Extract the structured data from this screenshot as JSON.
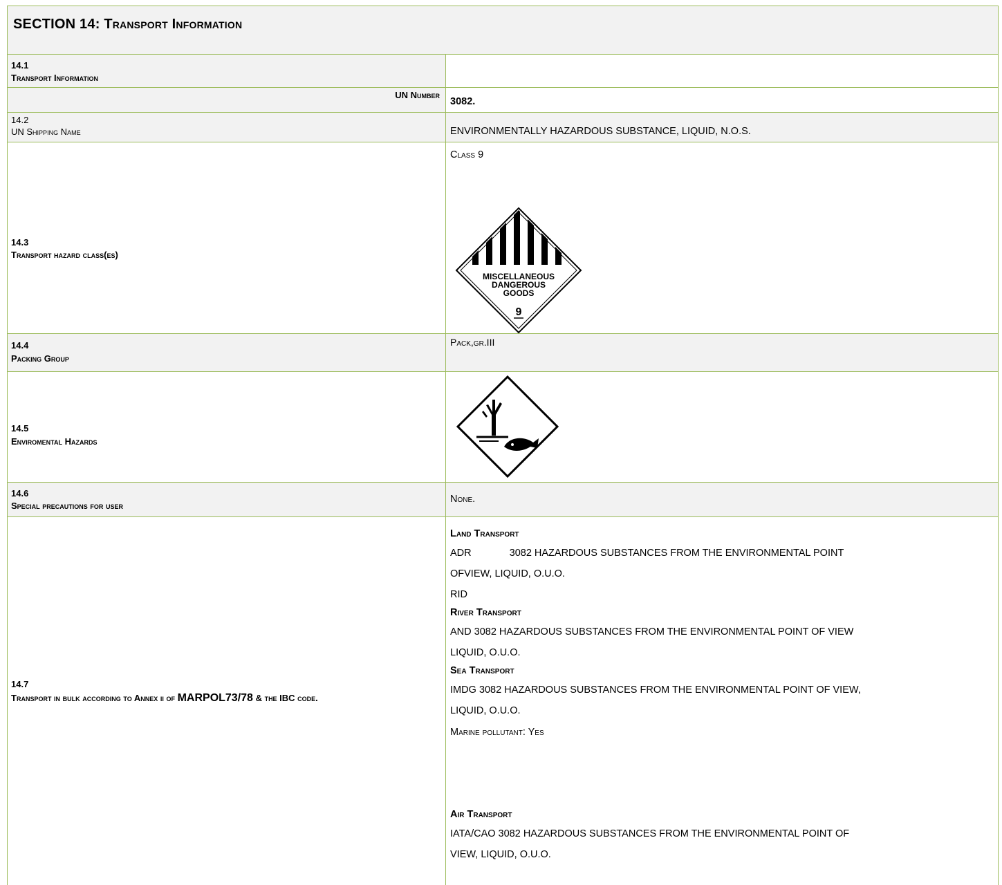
{
  "section": {
    "number_label": "SECTION 14:",
    "title": "Transport Information"
  },
  "rows": {
    "r1": {
      "number": "14.1",
      "label": "Transport Information"
    },
    "un": {
      "label": "UN Number",
      "value": "3082."
    },
    "r2": {
      "number": "14.2",
      "label": "UN Shipping Name",
      "value": "ENVIRONMENTALLY HAZARDOUS SUBSTANCE, LIQUID, N.O.S."
    },
    "r3": {
      "number": "14.3",
      "label": "Transport hazard class(es)",
      "value": "Class 9",
      "diamond_text": [
        "MISCELLANEOUS",
        "DANGEROUS",
        "GOODS"
      ],
      "diamond_class": "9"
    },
    "r4": {
      "number": "14.4",
      "label": "Packing Group",
      "value": "Pack,gr.III"
    },
    "r5": {
      "number": "14.5",
      "label": "Enviromental Hazards"
    },
    "r6": {
      "number": "14.6",
      "label": "Special precautions for user",
      "value": "None."
    },
    "r7": {
      "number": "14.7",
      "label_part1": "Transport in bulk according to Annex ii of ",
      "label_marpol": "MARPOL73/78",
      "label_part2": " & the IBC code.",
      "land_heading": "Land Transport",
      "adr_code": "ADR",
      "adr_text": "3082 HAZARDOUS SUBSTANCES FROM THE ENVIRONMENTAL POINT",
      "adr_text2": "OFVIEW, LIQUID, O.U.O.",
      "rid_code": "RID",
      "river_heading": "River Transport",
      "and_text": "AND  3082 HAZARDOUS SUBSTANCES FROM THE ENVIRONMENTAL POINT OF VIEW",
      "and_text2": "LIQUID, O.U.O.",
      "sea_heading": "Sea Transport",
      "imdg_text": "IMDG  3082 HAZARDOUS SUBSTANCES FROM THE ENVIRONMENTAL POINT OF VIEW,",
      "imdg_text2": "LIQUID, O.U.O.",
      "marine_pollutant": "Marine pollutant: Yes",
      "air_heading": "Air Transport",
      "iata_text": "IATA/CAO  3082 HAZARDOUS SUBSTANCES FROM THE ENVIRONMENTAL POINT OF",
      "iata_text2": "VIEW, LIQUID, O.U.O."
    }
  },
  "colors": {
    "border": "#9bbb59",
    "shade": "#f2f2f2"
  },
  "icons": [
    "class-9-hazard-diamond-icon",
    "environmental-hazard-icon"
  ]
}
